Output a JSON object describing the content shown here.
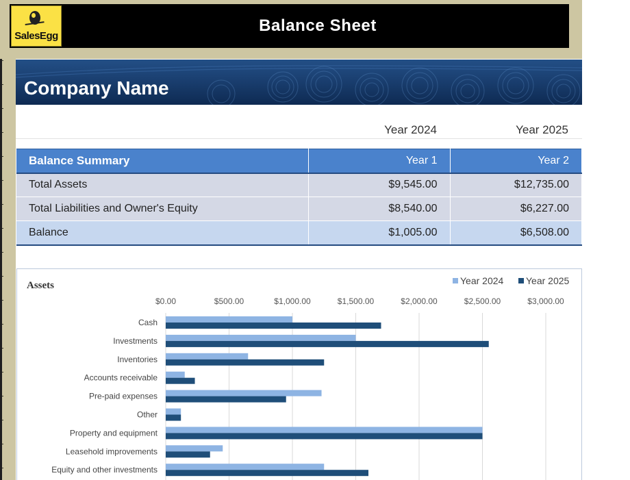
{
  "header": {
    "logo_text": "SalesEgg",
    "title": "Balance Sheet"
  },
  "banner": {
    "company_name": "Company Name"
  },
  "years": {
    "left": "Year 2024",
    "right": "Year 2025"
  },
  "summary": {
    "columns": [
      "Balance Summary",
      "Year 1",
      "Year 2"
    ],
    "rows": [
      {
        "label": "Total Assets",
        "year1": "$9,545.00",
        "year2": "$12,735.00"
      },
      {
        "label": "Total Liabilities and Owner's Equity",
        "year1": "$8,540.00",
        "year2": "$6,227.00"
      },
      {
        "label": "Balance",
        "year1": "$1,005.00",
        "year2": "$6,508.00"
      }
    ]
  },
  "colors": {
    "header_blue": "#4a82cc",
    "series_2024": "#8eb4e3",
    "series_2025": "#1f4e79",
    "logo_yellow": "#fbe145"
  },
  "chart_data": {
    "type": "bar",
    "orientation": "horizontal",
    "title": "Assets",
    "legend_position": "top-right",
    "grid": true,
    "xlim": [
      0,
      3000
    ],
    "x_ticks": [
      0,
      500,
      1000,
      1500,
      2000,
      2500,
      3000
    ],
    "x_tick_labels": [
      "$0.00",
      "$500.00",
      "$1,000.00",
      "$1,500.00",
      "$2,000.00",
      "$2,500.00",
      "$3,000.00"
    ],
    "categories": [
      "Cash",
      "Investments",
      "Inventories",
      "Accounts receivable",
      "Pre-paid expenses",
      "Other",
      "Property and equipment",
      "Leasehold improvements",
      "Equity and other investments"
    ],
    "series": [
      {
        "name": "Year 2024",
        "color": "#8eb4e3",
        "values": [
          1000,
          1500,
          650,
          150,
          1230,
          120,
          2500,
          450,
          1250
        ]
      },
      {
        "name": "Year 2025",
        "color": "#1f4e79",
        "values": [
          1700,
          2550,
          1250,
          230,
          950,
          120,
          2500,
          350,
          1600
        ]
      }
    ]
  }
}
